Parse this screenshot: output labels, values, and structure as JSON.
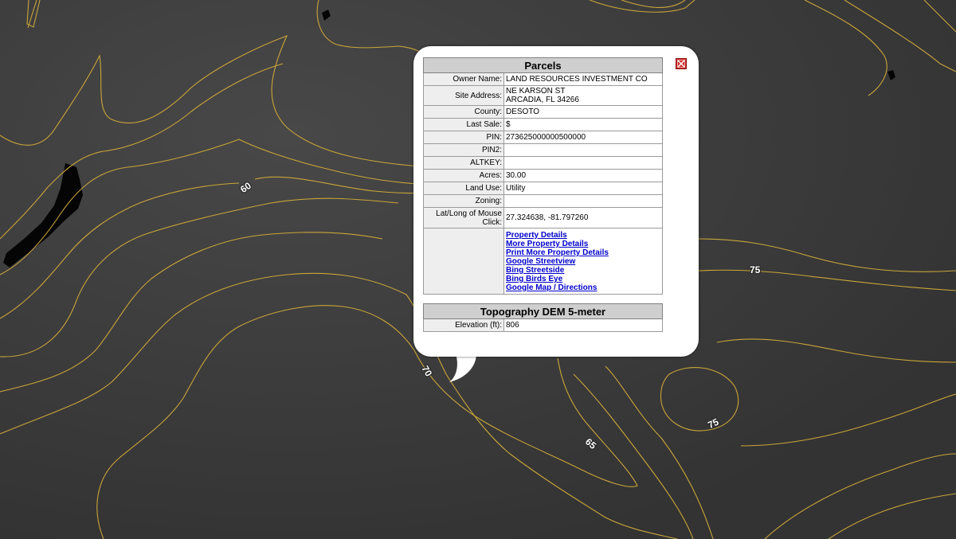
{
  "popup": {
    "close_icon": "close-icon",
    "parcels": {
      "title": "Parcels",
      "rows": [
        {
          "label": "Owner Name:",
          "value": "LAND RESOURCES INVESTMENT CO"
        },
        {
          "label": "Site Address:",
          "value": "NE KARSON ST",
          "value2": "ARCADIA, FL 34266"
        },
        {
          "label": "County:",
          "value": "DESOTO"
        },
        {
          "label": "Last Sale:",
          "value": "$"
        },
        {
          "label": "PIN:",
          "value": "273625000000500000"
        },
        {
          "label": "PIN2:",
          "value": ""
        },
        {
          "label": "ALTKEY:",
          "value": ""
        },
        {
          "label": "Acres:",
          "value": "30.00"
        },
        {
          "label": "Land Use:",
          "value": "Utility"
        },
        {
          "label": "Zoning:",
          "value": ""
        },
        {
          "label": "Lat/Long of Mouse Click:",
          "value": "27.324638, -81.797260"
        }
      ],
      "links": [
        "Property Details",
        "More Property Details",
        "Print More Property Details",
        "Google Streetview",
        "Bing Streetside",
        "Bing Birds Eye",
        "Google Map / Directions"
      ]
    },
    "topography": {
      "title": "Topography DEM 5-meter",
      "rows": [
        {
          "label": "Elevation (ft):",
          "value": "806"
        }
      ]
    }
  },
  "map": {
    "contour_color": "#c9a53a",
    "background_color": "#3a3a3a",
    "contour_labels": [
      "60",
      "70",
      "65",
      "75",
      "75"
    ]
  }
}
